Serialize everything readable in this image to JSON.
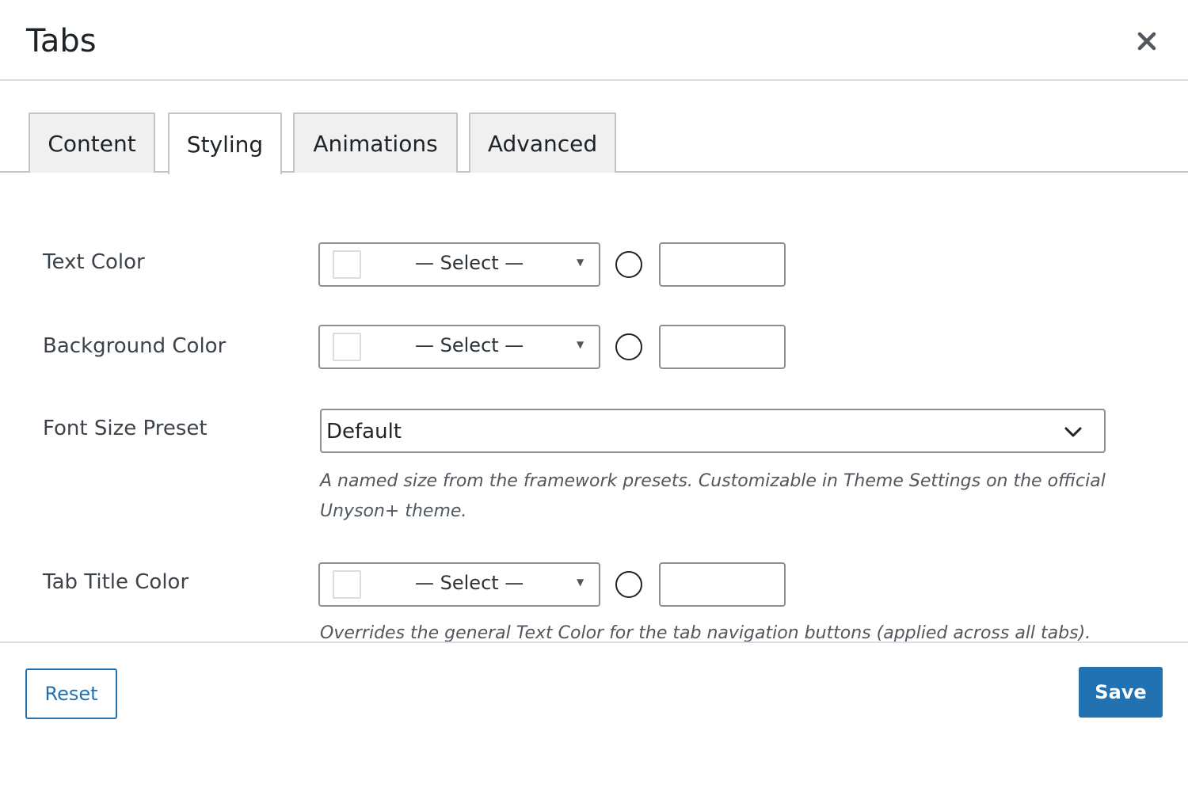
{
  "modal": {
    "title": "Tabs",
    "close_icon": "close-icon"
  },
  "tabs": [
    {
      "label": "Content",
      "active": false
    },
    {
      "label": "Styling",
      "active": true
    },
    {
      "label": "Animations",
      "active": false
    },
    {
      "label": "Advanced",
      "active": false
    }
  ],
  "fields": {
    "text_color": {
      "label": "Text Color",
      "select_value": "— Select —",
      "hex_value": ""
    },
    "background_color": {
      "label": "Background Color",
      "select_value": "— Select —",
      "hex_value": ""
    },
    "font_size_preset": {
      "label": "Font Size Preset",
      "selected": "Default",
      "help": "A named size from the framework presets. Customizable in Theme Settings on the official Unyson+ theme."
    },
    "tab_title_color": {
      "label": "Tab Title Color",
      "select_value": "— Select —",
      "hex_value": "",
      "help": "Overrides the general Text Color for the tab navigation buttons (applied across all tabs)."
    }
  },
  "footer": {
    "reset_label": "Reset",
    "save_label": "Save"
  },
  "colors": {
    "primary": "#2271b1",
    "border": "#8c8f94",
    "tab_inactive_bg": "#f0f0f1"
  }
}
